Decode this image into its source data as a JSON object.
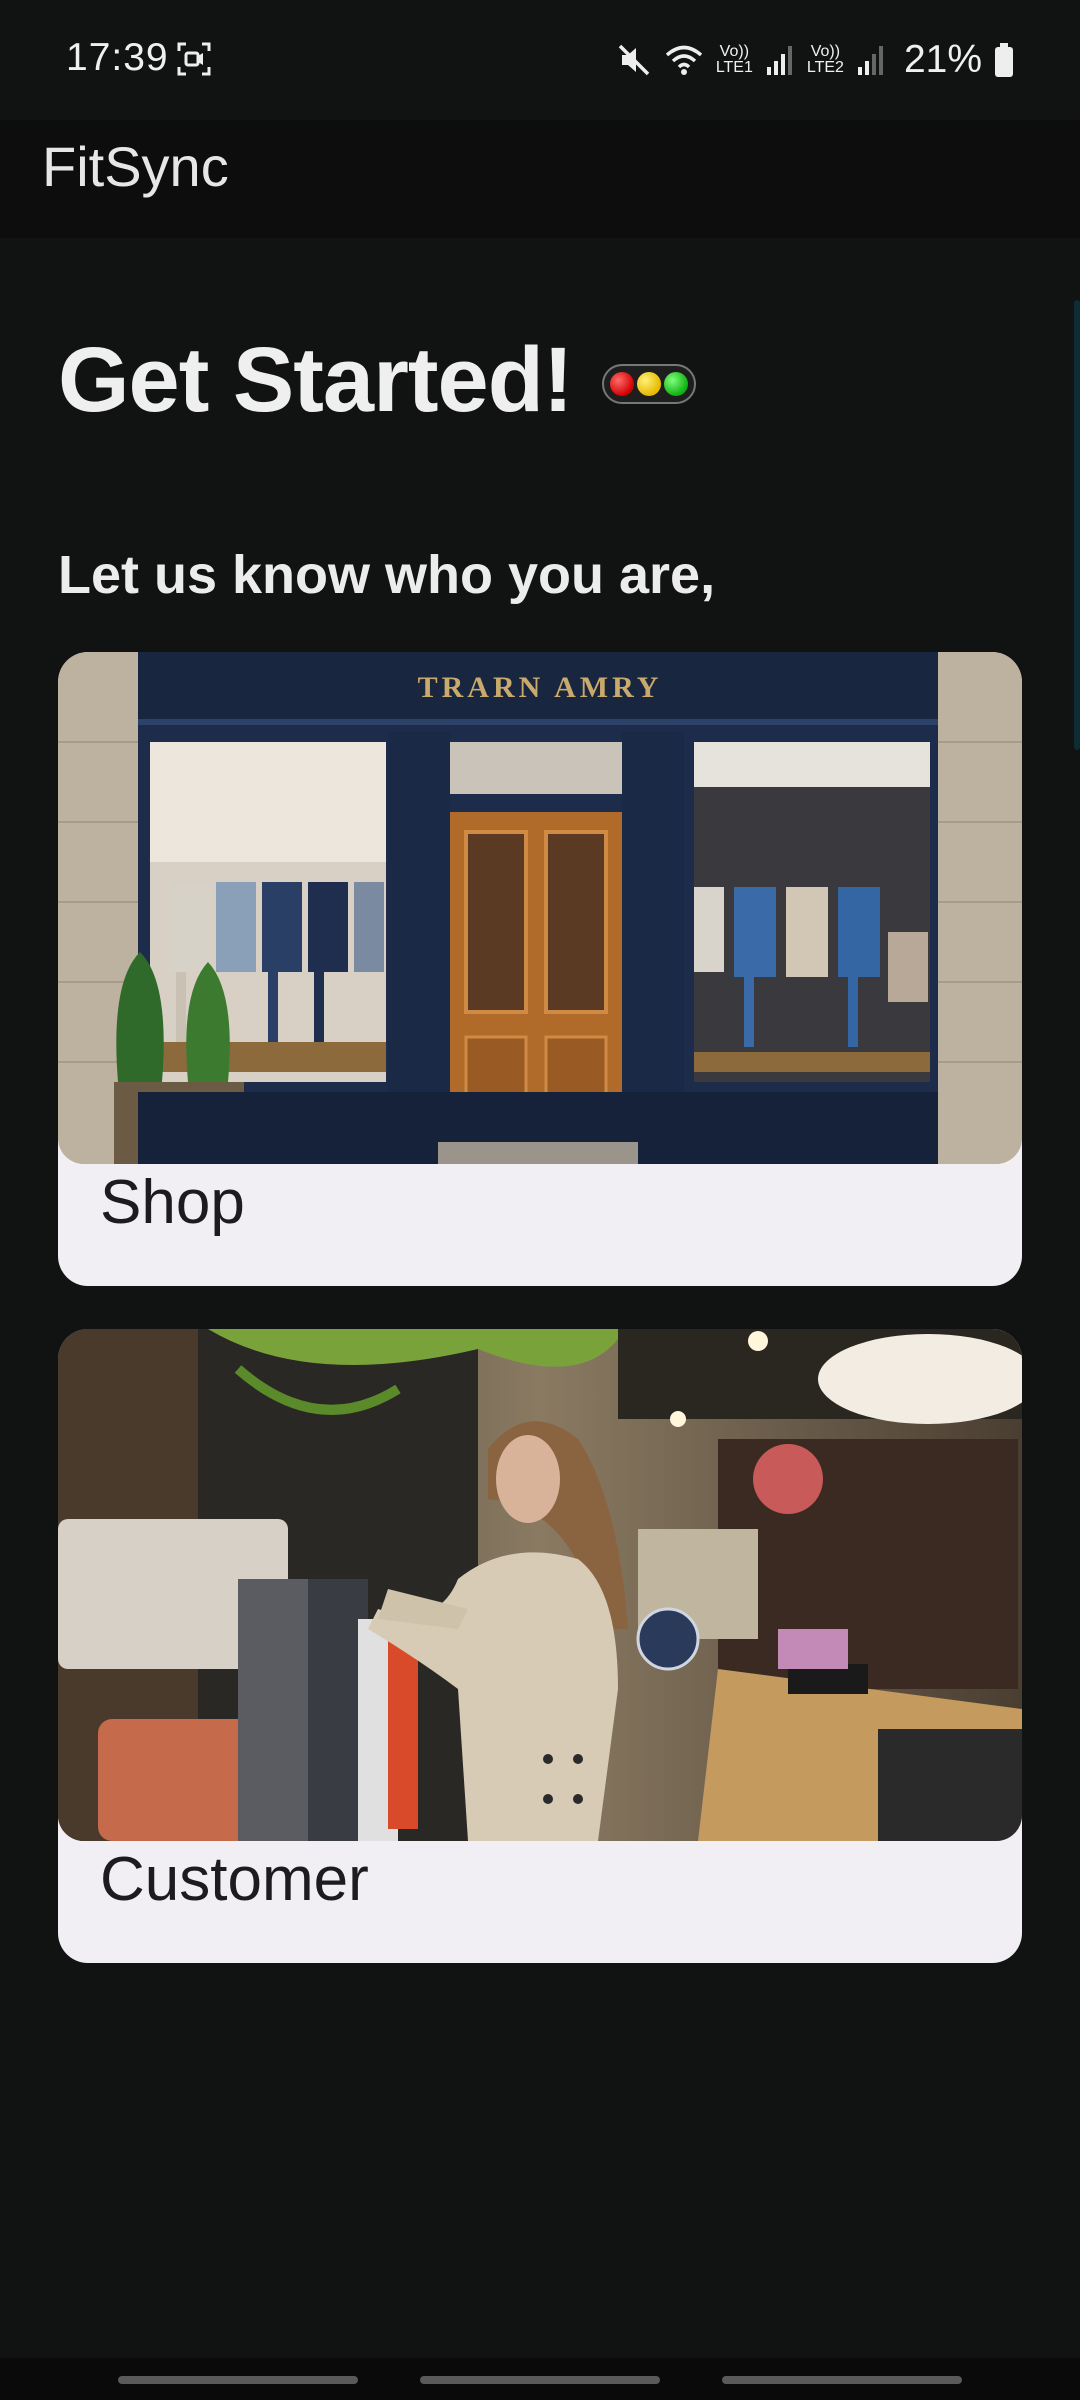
{
  "status_bar": {
    "time": "17:39",
    "battery": "21%",
    "lte1_top": "Vo))",
    "lte1_bottom": "LTE1",
    "lte2_top": "Vo))",
    "lte2_bottom": "LTE2",
    "icons": [
      "screen-record-icon",
      "mute-icon",
      "wifi-icon",
      "signal-icon",
      "signal-icon",
      "battery-icon"
    ]
  },
  "app_bar": {
    "title": "FitSync"
  },
  "main": {
    "heading": "Get Started!",
    "subtitle": "Let us know who you are,",
    "cards": [
      {
        "label": "Shop",
        "sign_text": "TRARN AMRY"
      },
      {
        "label": "Customer"
      }
    ]
  },
  "colors": {
    "background": "#111313",
    "card": "#f1eef4",
    "heading": "#efefef"
  }
}
